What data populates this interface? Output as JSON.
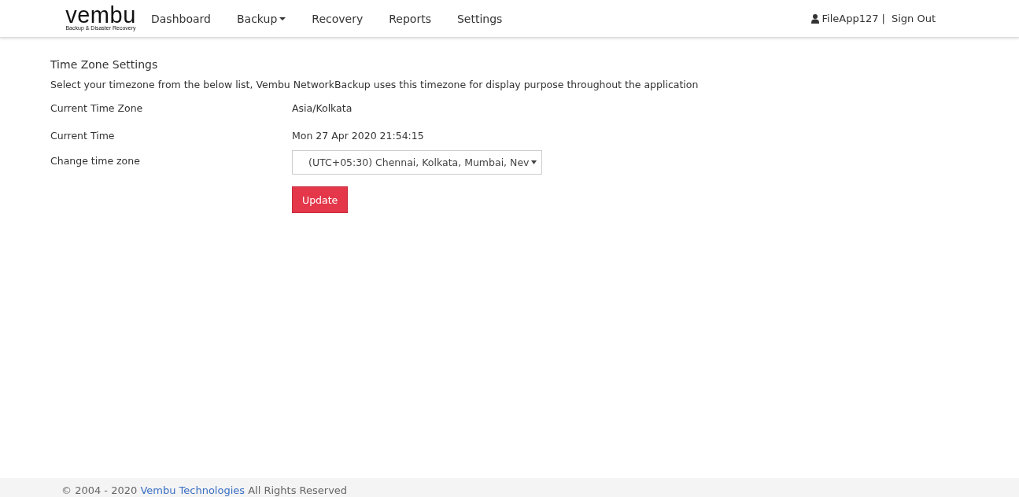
{
  "logo": {
    "text": "vembu",
    "tagline": "Backup & Disaster Recovery"
  },
  "nav": [
    {
      "label": "Dashboard",
      "has_menu": false
    },
    {
      "label": "Backup",
      "has_menu": true
    },
    {
      "label": "Recovery",
      "has_menu": false
    },
    {
      "label": "Reports",
      "has_menu": false
    },
    {
      "label": "Settings",
      "has_menu": false
    }
  ],
  "user": {
    "name": "FileApp127",
    "separator": "|",
    "sign_out": "Sign Out"
  },
  "section": {
    "title": "Time Zone Settings",
    "description": "Select your timezone from the below list, Vembu NetworkBackup uses this timezone for display purpose throughout the application"
  },
  "fields": [
    {
      "kind": "text",
      "label": "Current Time Zone",
      "value": "Asia/Kolkata"
    },
    {
      "kind": "text",
      "label": "Current Time",
      "value": "Mon 27 Apr 2020 21:54:15"
    },
    {
      "kind": "select",
      "label": "Change time zone",
      "value": "(UTC+05:30) Chennai, Kolkata, Mumbai, Nev"
    }
  ],
  "update_button": "Update",
  "footer": {
    "before": "© 2004 - 2020",
    "link": "Vembu Technologies",
    "after": "All Rights Reserved"
  }
}
